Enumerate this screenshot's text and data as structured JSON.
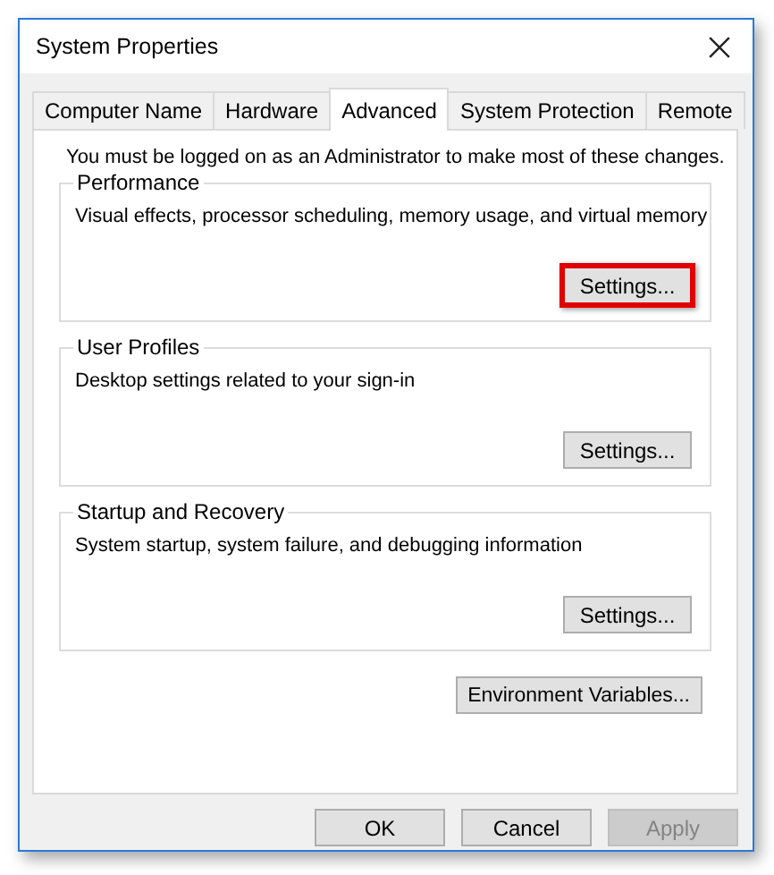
{
  "window": {
    "title": "System Properties"
  },
  "tabs": [
    {
      "label": "Computer Name",
      "selected": false
    },
    {
      "label": "Hardware",
      "selected": false
    },
    {
      "label": "Advanced",
      "selected": true
    },
    {
      "label": "System Protection",
      "selected": false
    },
    {
      "label": "Remote",
      "selected": false
    }
  ],
  "notice": "You must be logged on as an Administrator to make most of these changes.",
  "groups": [
    {
      "title": "Performance",
      "description": "Visual effects, processor scheduling, memory usage, and virtual memory",
      "button": {
        "label": "Settings...",
        "highlighted": true
      }
    },
    {
      "title": "User Profiles",
      "description": "Desktop settings related to your sign-in",
      "button": {
        "label": "Settings...",
        "highlighted": false
      }
    },
    {
      "title": "Startup and Recovery",
      "description": "System startup, system failure, and debugging information",
      "button": {
        "label": "Settings...",
        "highlighted": false
      }
    }
  ],
  "environment_button": {
    "label": "Environment Variables..."
  },
  "footer_buttons": [
    {
      "label": "OK",
      "disabled": false
    },
    {
      "label": "Cancel",
      "disabled": false
    },
    {
      "label": "Apply",
      "disabled": true
    }
  ]
}
